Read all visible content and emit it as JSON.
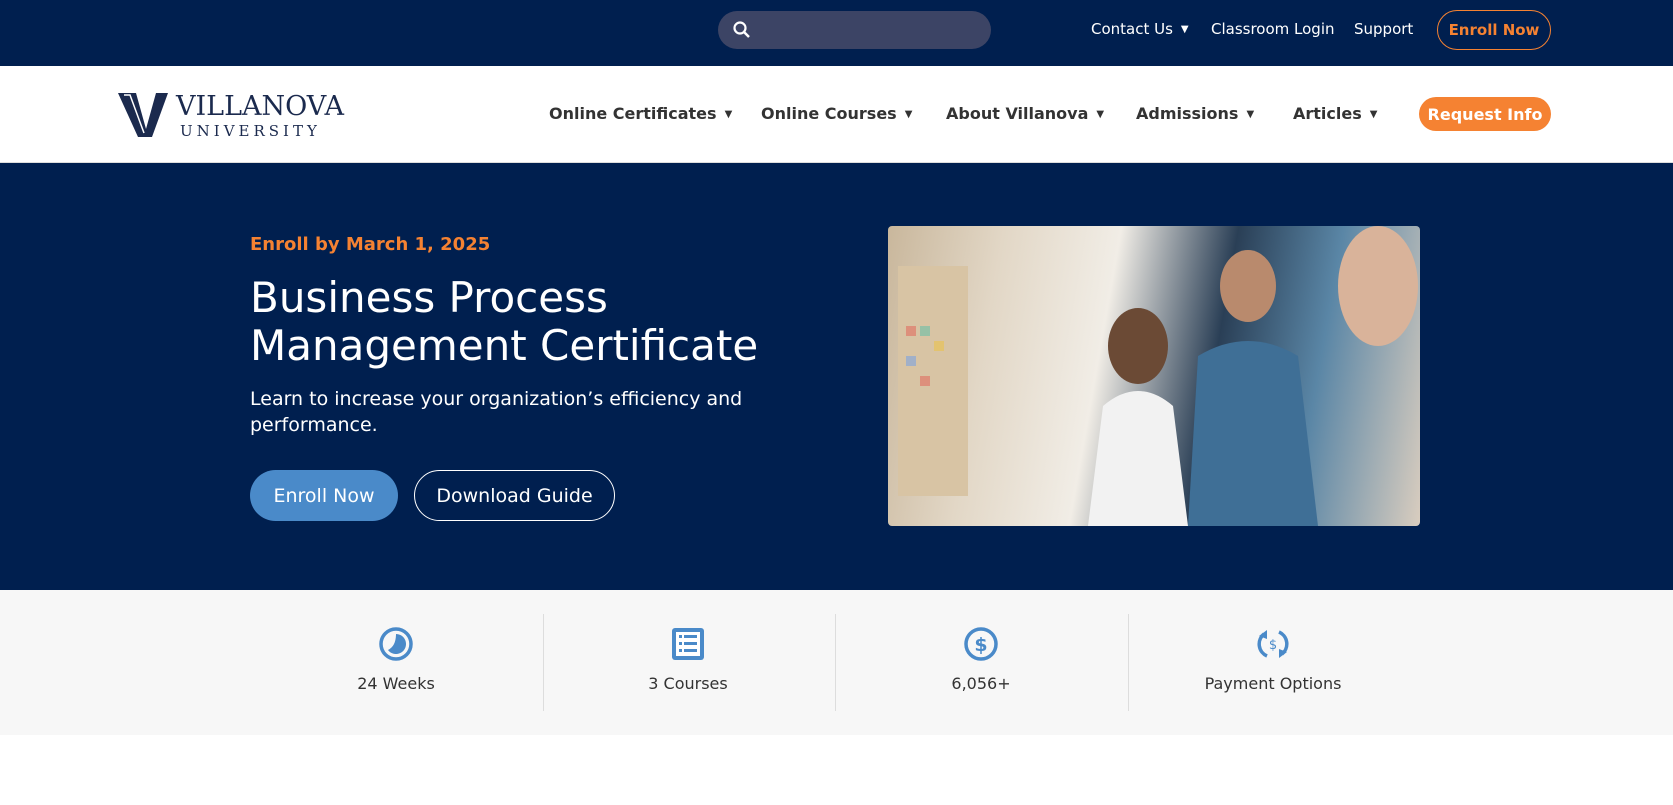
{
  "topbar": {
    "search_placeholder": "",
    "links": [
      "Contact Us",
      "Classroom Login",
      "Support"
    ],
    "enroll_label": "Enroll Now"
  },
  "nav": {
    "logo_text": "VILLANOVA UNIVERSITY",
    "items": [
      "Online Certificates",
      "Online Courses",
      "About Villanova",
      "Admissions",
      "Articles"
    ],
    "request_label": "Request Info"
  },
  "hero": {
    "kicker": "Enroll by March 1, 2025",
    "title": "Business Process Management Certificate",
    "subtitle": "Learn to increase your organization’s efficiency and performance.",
    "enroll_label": "Enroll Now",
    "guide_label": "Download Guide"
  },
  "stats": [
    {
      "icon": "clock-icon",
      "label": "24 Weeks"
    },
    {
      "icon": "list-icon",
      "label": "3 Courses"
    },
    {
      "icon": "dollar-icon",
      "label": "6,056+"
    },
    {
      "icon": "payment-cycle-icon",
      "label": "Payment Options"
    }
  ],
  "colors": {
    "navy": "#001f4f",
    "orange": "#f58232",
    "blue": "#4a8ac9"
  }
}
